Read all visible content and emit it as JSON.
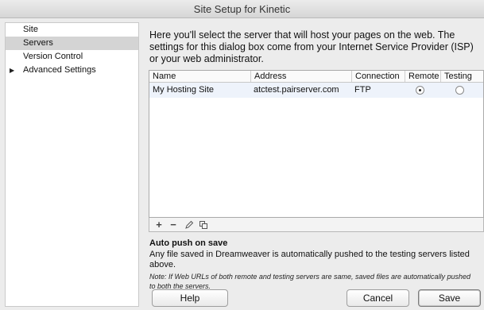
{
  "window": {
    "title": "Site Setup for Kinetic"
  },
  "sidebar": {
    "items": [
      {
        "label": "Site",
        "selected": false
      },
      {
        "label": "Servers",
        "selected": true
      },
      {
        "label": "Version Control",
        "selected": false
      },
      {
        "label": "Advanced Settings",
        "selected": false,
        "collapsed": true
      }
    ]
  },
  "intro": "Here you'll select the server that will host your pages on the web. The settings for this dialog box come from your Internet Service Provider (ISP) or your web administrator.",
  "servers_table": {
    "columns": [
      "Name",
      "Address",
      "Connection",
      "Remote",
      "Testing"
    ],
    "rows": [
      {
        "name": "My Hosting Site",
        "address": "atctest.pairserver.com",
        "connection": "FTP",
        "remote": true,
        "testing": false
      }
    ]
  },
  "toolbar": {
    "icons": [
      "plus-icon",
      "minus-icon",
      "pencil-icon",
      "duplicate-icon"
    ]
  },
  "auto_push": {
    "title": "Auto push on save",
    "description": "Any file saved in Dreamweaver is automatically pushed to the testing servers listed above.",
    "note": "Note: If Web URLs of both remote and testing servers are same, saved files are automatically pushed to both the servers."
  },
  "buttons": {
    "help": "Help",
    "cancel": "Cancel",
    "save": "Save"
  }
}
